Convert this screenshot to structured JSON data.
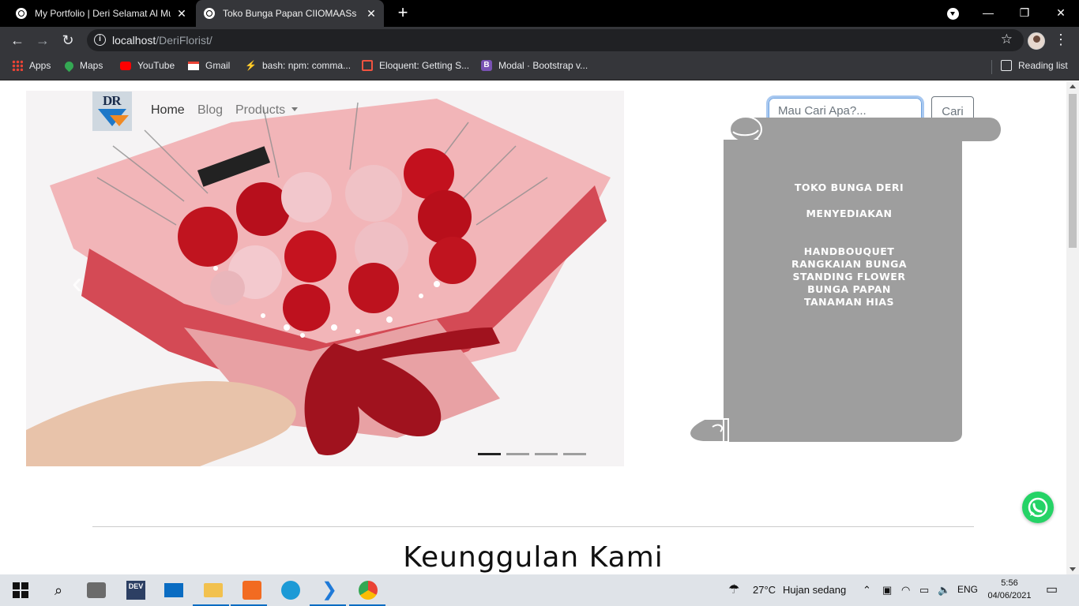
{
  "browser": {
    "tabs": [
      {
        "title": "My Portfolio | Deri Selamat Al Mu",
        "active": false
      },
      {
        "title": "Toko Bunga Papan CIIOMAASs",
        "active": true
      }
    ],
    "url_host": "localhost",
    "url_path": "/DeriFlorist/",
    "bookmarks": [
      {
        "label": "Apps",
        "icon": "apps-grid-icon"
      },
      {
        "label": "Maps",
        "icon": "maps-pin-icon"
      },
      {
        "label": "YouTube",
        "icon": "youtube-icon"
      },
      {
        "label": "Gmail",
        "icon": "gmail-icon"
      },
      {
        "label": "bash: npm: comma...",
        "icon": "bash-icon"
      },
      {
        "label": "Eloquent: Getting S...",
        "icon": "laravel-icon"
      },
      {
        "label": "Modal · Bootstrap v...",
        "icon": "bootstrap-icon"
      }
    ],
    "reading_list": "Reading list"
  },
  "page": {
    "logo_text": "DR",
    "nav": {
      "home": "Home",
      "blog": "Blog",
      "products": "Products"
    },
    "search": {
      "placeholder": "Mau Cari Apa?...",
      "button": "Cari"
    },
    "scroll": {
      "line1": "TOKO BUNGA DERI",
      "line2": "MENYEDIAKAN",
      "items": [
        "HANDBOUQUET",
        "RANGKAIAN BUNGA",
        "STANDING FLOWER",
        "BUNGA PAPAN",
        "TANAMAN HIAS"
      ]
    },
    "carousel": {
      "slides": 4,
      "active_index": 0
    },
    "heading": "Keunggulan Kami"
  },
  "taskbar": {
    "weather_temp": "27°C",
    "weather_desc": "Hujan sedang",
    "lang": "ENG",
    "time": "5:56",
    "date": "04/06/2021"
  },
  "colors": {
    "scroll_gray": "#9e9e9e",
    "accent_blue": "#0a6cc2",
    "whatsapp": "#25d366"
  }
}
